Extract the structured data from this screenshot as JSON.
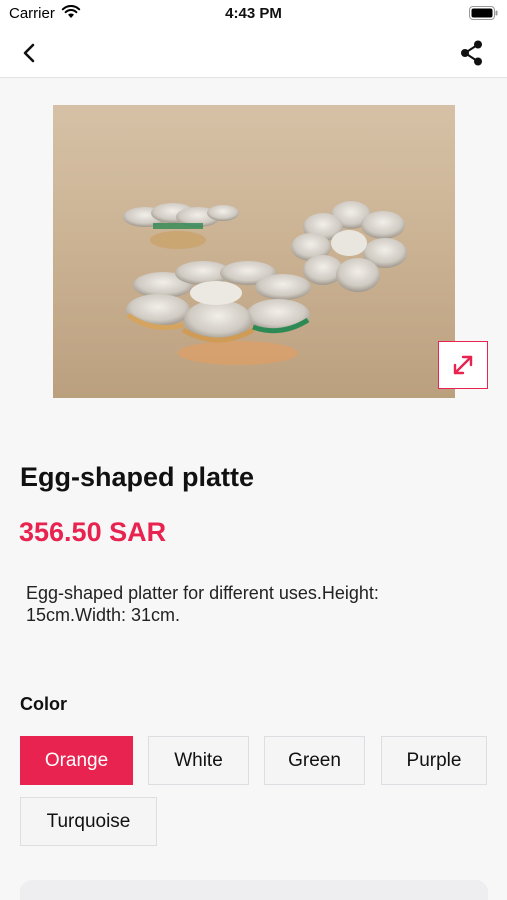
{
  "status_bar": {
    "carrier": "Carrier",
    "time": "4:43 PM"
  },
  "nav": {
    "back_icon": "chevron-left-icon",
    "share_icon": "share-icon"
  },
  "product": {
    "title": "Egg-shaped platte",
    "price": "356.50 SAR",
    "description": "Egg-shaped platter for different uses.Height: 15cm.Width: 31cm.",
    "expand_icon": "expand-arrows-icon"
  },
  "color": {
    "label": "Color",
    "selected": "Orange",
    "options": [
      "Orange",
      "White",
      "Green",
      "Purple",
      "Turquoise"
    ]
  },
  "theme": {
    "accent": "#e8234f"
  }
}
